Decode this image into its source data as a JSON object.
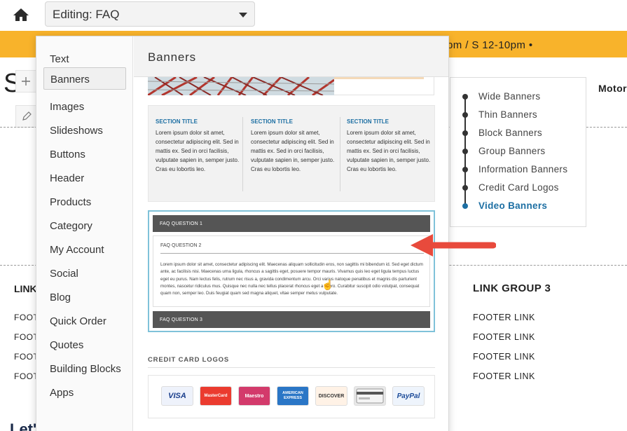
{
  "topbar": {
    "home_icon": "home-icon",
    "editing_label": "Editing: FAQ"
  },
  "site": {
    "promo_text": "pm / S 12-10pm •",
    "title_fragment": "S",
    "motor_fragment": "Motor",
    "timeline": [
      {
        "label": "Wide Banners"
      },
      {
        "label": "Thin Banners"
      },
      {
        "label": "Block Banners"
      },
      {
        "label": "Group Banners"
      },
      {
        "label": "Information Banners"
      },
      {
        "label": "Credit Card Logos"
      },
      {
        "label": "Video Banners",
        "active": true
      }
    ],
    "link_group_left_fragment": "LINK",
    "link_group_right": "LINK GROUP 3",
    "footer_links_left": [
      "FOOT",
      "FOOT",
      "FOOT",
      "FOOT"
    ],
    "footer_links_right": [
      "FOOTER LINK",
      "FOOTER LINK",
      "FOOTER LINK",
      "FOOTER LINK"
    ],
    "bottom_fragment": "Let'"
  },
  "panel": {
    "title": "Banners",
    "sidebar": [
      {
        "label": "Text"
      },
      {
        "label": "Banners",
        "active": true
      },
      {
        "label": "Images"
      },
      {
        "label": "Slideshows"
      },
      {
        "label": "Buttons"
      },
      {
        "label": "Header"
      },
      {
        "label": "Products"
      },
      {
        "label": "Category"
      },
      {
        "label": "My Account"
      },
      {
        "label": "Social"
      },
      {
        "label": "Blog"
      },
      {
        "label": "Quick Order"
      },
      {
        "label": "Quotes"
      },
      {
        "label": "Building Blocks"
      },
      {
        "label": "Apps"
      }
    ],
    "sections": [
      {
        "title": "SECTION TITLE",
        "body": "Lorem ipsum dolor sit amet, consectetur adipiscing elit. Sed in mattis ex. Sed in orci facilisis, vulputate sapien in, semper justo. Cras eu lobortis leo."
      },
      {
        "title": "SECTION TITLE",
        "body": "Lorem ipsum dolor sit amet, consectetur adipiscing elit. Sed in mattis ex. Sed in orci facilisis, vulputate sapien in, semper justo. Cras eu lobortis leo."
      },
      {
        "title": "SECTION TITLE",
        "body": "Lorem ipsum dolor sit amet, consectetur adipiscing elit. Sed in mattis ex. Sed in orci facilisis, vulputate sapien in, semper justo. Cras eu lobortis leo."
      }
    ],
    "faq": {
      "q1": "FAQ QUESTION 1",
      "q2": "FAQ QUESTION 2",
      "q2_body": "Lorem ipsum dolor sit amet, consectetur adipiscing elit. Maecenas aliquam sollicitudin eros, non sagittis mi bibendum id. Sed eget dictum ante, ac facilisis nisi. Maecenas urna ligula, rhoncus a sagittis eget, posuere tempor mauris. Vivamus quis leo eget ligula tempus luctus eget eu purus. Nam lectus felis, rutrum nec risus a, gravida condimentum arcu. Orci varius natoque penatibus et magnis dis parturient montes, nascetur ridiculus mus. Quisque nec nulla nec tellus placerat rhoncus eget a libero. Curabitur suscipit odio volutpat, consequat quam non, semper leo. Duis feugiat quam sed magna aliquet, vitae semper metus vulputate.",
      "q3": "FAQ QUESTION 3"
    },
    "credit_cards": {
      "label": "CREDIT CARD LOGOS",
      "logos": [
        {
          "name": "VISA",
          "color": "#1a3e8c",
          "bg": "#eef2fb"
        },
        {
          "name": "MasterCard",
          "color": "#ffffff",
          "bg": "#eb3b2f"
        },
        {
          "name": "Maestro",
          "color": "#ffffff",
          "bg": "#d33a6b"
        },
        {
          "name": "AMERICAN EXPRESS",
          "color": "#ffffff",
          "bg": "#2a76c6"
        },
        {
          "name": "DISCOVER",
          "color": "#333333",
          "bg": "#fff2e6"
        },
        {
          "name": "",
          "color": "#333333",
          "bg": "#e8e8e8"
        },
        {
          "name": "PayPal",
          "color": "#1b4a98",
          "bg": "#eef4fc"
        }
      ]
    }
  },
  "colors": {
    "promo": "#f8b32b",
    "accent": "#1d6fa3",
    "arrow": "#e84a3c",
    "faq_bar": "#555555"
  }
}
